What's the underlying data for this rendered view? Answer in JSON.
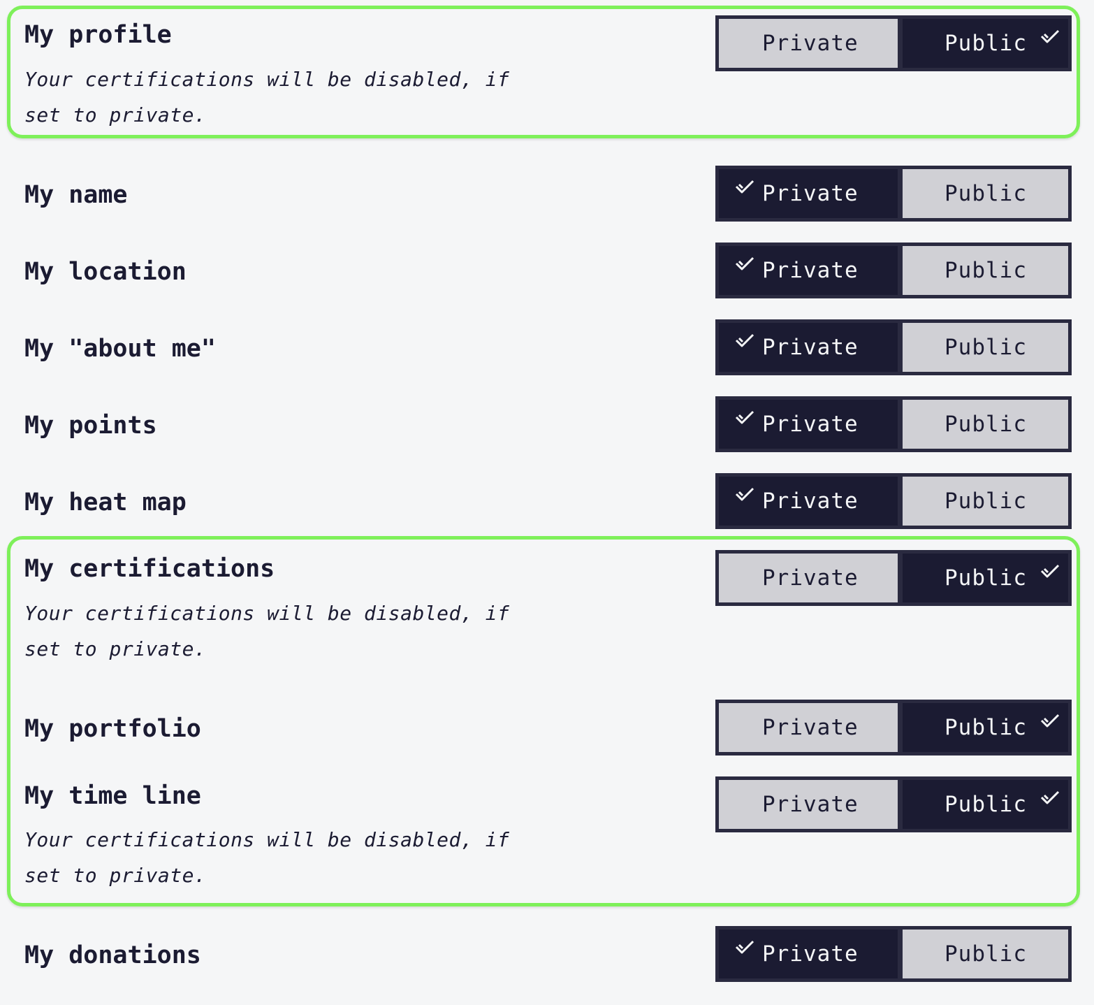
{
  "note_text": "Your certifications will be disabled, if set to private.",
  "options": {
    "private": "Private",
    "public": "Public"
  },
  "settings": [
    {
      "id": "profile",
      "label": "My profile",
      "value": "Public",
      "note": true
    },
    {
      "id": "name",
      "label": "My name",
      "value": "Private",
      "note": false
    },
    {
      "id": "location",
      "label": "My location",
      "value": "Private",
      "note": false
    },
    {
      "id": "about",
      "label": "My \"about me\"",
      "value": "Private",
      "note": false
    },
    {
      "id": "points",
      "label": "My points",
      "value": "Private",
      "note": false
    },
    {
      "id": "heatmap",
      "label": "My heat map",
      "value": "Private",
      "note": false
    },
    {
      "id": "certifications",
      "label": "My certifications",
      "value": "Public",
      "note": true
    },
    {
      "id": "portfolio",
      "label": "My portfolio",
      "value": "Public",
      "note": false
    },
    {
      "id": "timeline",
      "label": "My time line",
      "value": "Public",
      "note": true
    },
    {
      "id": "donations",
      "label": "My donations",
      "value": "Private",
      "note": false
    }
  ],
  "colors": {
    "highlight_border": "#7ef05a",
    "selected_bg": "#1b1b32",
    "unselected_bg": "#d0d0d5",
    "page_bg": "#f5f6f7"
  },
  "icons": {
    "selected_marker": "check-icon"
  }
}
